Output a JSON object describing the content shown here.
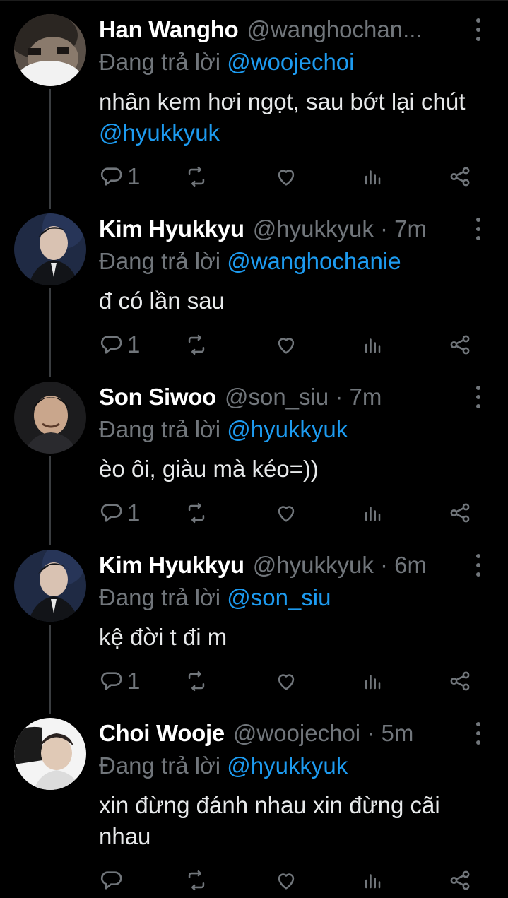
{
  "colors": {
    "background": "#000000",
    "text": "#e7e9ea",
    "muted": "#71767b",
    "mention": "#1d9bf0",
    "thread_line": "#3a3d40"
  },
  "tweets": [
    {
      "name": "Han Wangho",
      "handle": "@wanghochan...",
      "time": "",
      "replying_prefix": "Đang trả lời",
      "replying_to": "@woojechoi",
      "text": "nhân kem hơi ngọt, sau bớt lại chút",
      "text_mention": "@hyukkyuk",
      "reply_count": "1",
      "avatar_icon": "avatar-han-wangho"
    },
    {
      "name": "Kim Hyukkyu",
      "handle": "@hyukkyuk",
      "time": "· 7m",
      "replying_prefix": "Đang trả lời",
      "replying_to": "@wanghochanie",
      "text": "đ có lần sau",
      "text_mention": "",
      "reply_count": "1",
      "avatar_icon": "avatar-kim-hyukkyu"
    },
    {
      "name": "Son Siwoo",
      "handle": "@son_siu",
      "time": "· 7m",
      "replying_prefix": "Đang trả lời",
      "replying_to": "@hyukkyuk",
      "text": "èo ôi, giàu mà kéo=))",
      "text_mention": "",
      "reply_count": "1",
      "avatar_icon": "avatar-son-siwoo"
    },
    {
      "name": "Kim Hyukkyu",
      "handle": "@hyukkyuk",
      "time": "· 6m",
      "replying_prefix": "Đang trả lời",
      "replying_to": "@son_siu",
      "text": "kệ đời t đi m",
      "text_mention": "",
      "reply_count": "1",
      "avatar_icon": "avatar-kim-hyukkyu"
    },
    {
      "name": "Choi Wooje",
      "handle": "@woojechoi",
      "time": "· 5m",
      "replying_prefix": "Đang trả lời",
      "replying_to": "@hyukkyuk",
      "text": "xin đừng đánh nhau xin đừng cãi nhau",
      "text_mention": "",
      "reply_count": "",
      "avatar_icon": "avatar-choi-wooje"
    }
  ],
  "action_icons": [
    "reply-icon",
    "retweet-icon",
    "like-icon",
    "views-icon",
    "share-icon"
  ]
}
